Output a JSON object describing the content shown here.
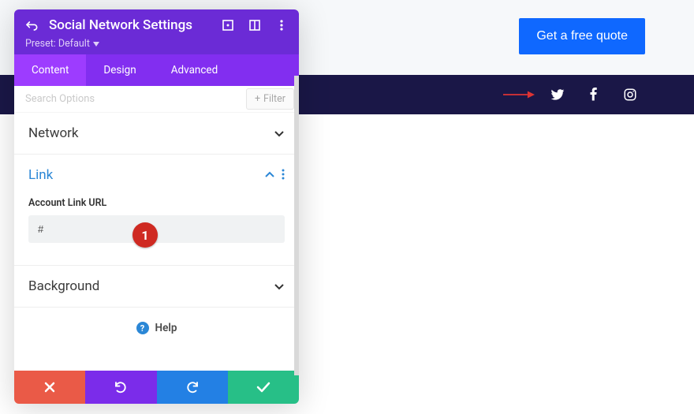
{
  "page": {
    "cta_label": "Get a free quote"
  },
  "panel": {
    "title": "Social Network Settings",
    "preset_label": "Preset: Default",
    "tabs": {
      "content": "Content",
      "design": "Design",
      "advanced": "Advanced"
    },
    "search_placeholder": "Search Options",
    "filter_label": "Filter",
    "sections": {
      "network": "Network",
      "link": "Link",
      "background": "Background"
    },
    "link_section": {
      "field_label": "Account Link URL",
      "value": "#"
    },
    "help_label": "Help"
  },
  "callouts": {
    "badge1": "1"
  },
  "icons": {
    "back": "back-icon",
    "expand": "expand-icon",
    "layout": "layout-toggle-icon",
    "kebab": "more-vertical-icon",
    "plus": "+",
    "chevron_down": "chevron-down",
    "chevron_up": "chevron-up",
    "twitter": "twitter-icon",
    "facebook": "facebook-icon",
    "instagram": "instagram-icon",
    "close": "close-icon",
    "undo": "undo-icon",
    "redo": "redo-icon",
    "check": "check-icon"
  }
}
